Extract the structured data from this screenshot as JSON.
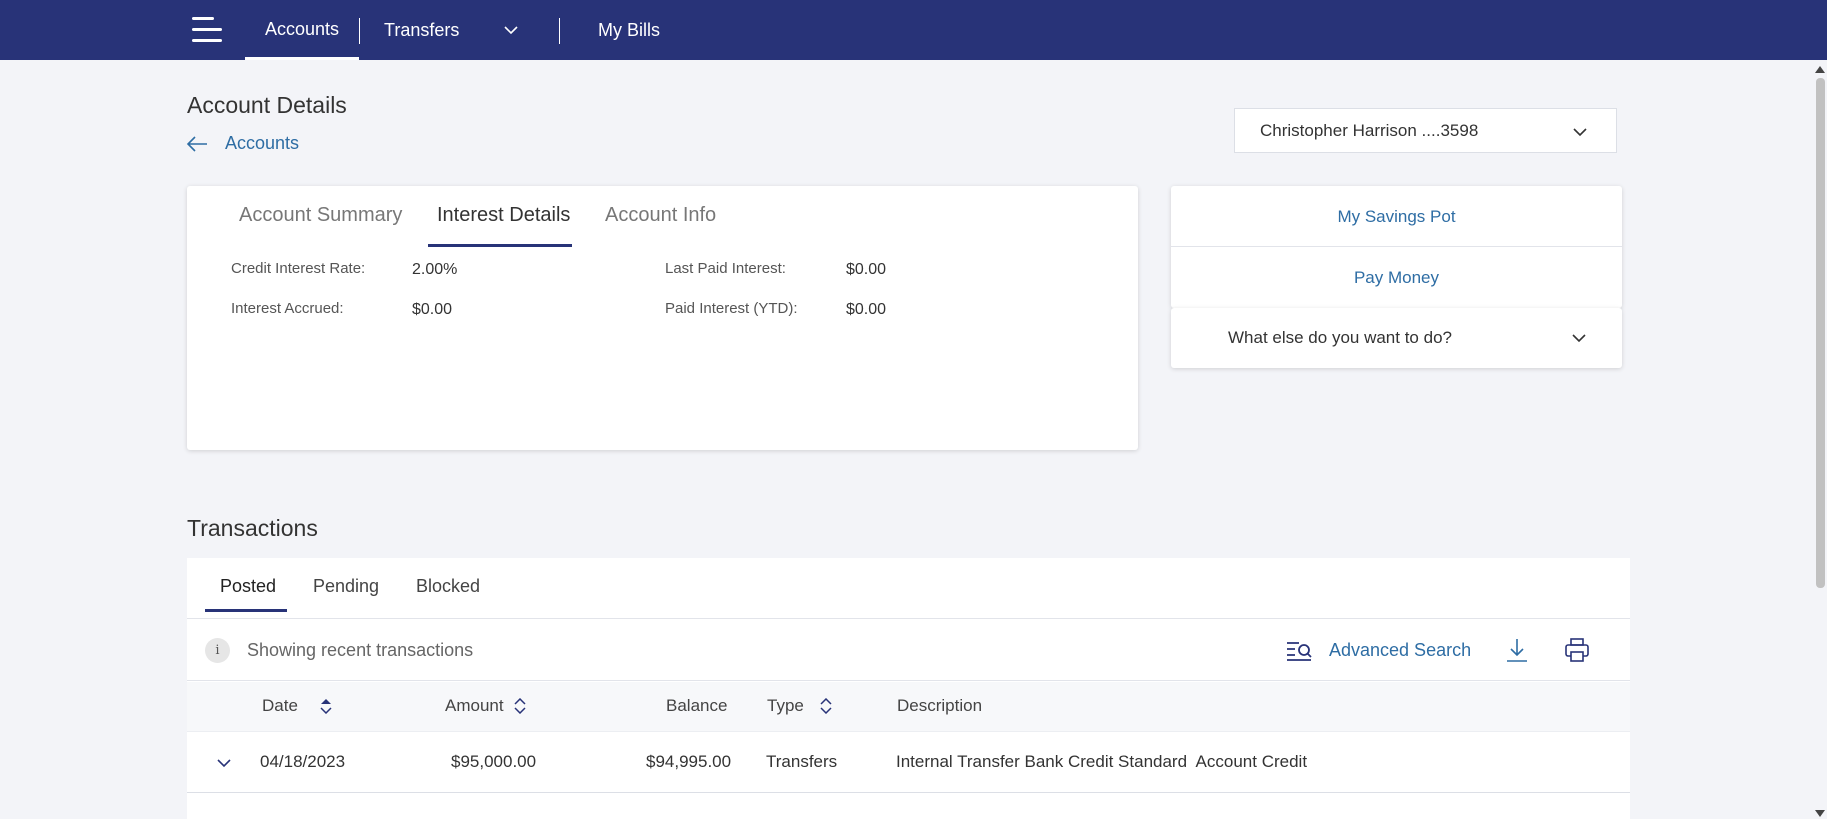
{
  "nav": {
    "items": [
      {
        "label": "Accounts"
      },
      {
        "label": "Transfers"
      },
      {
        "label": "My Bills"
      }
    ]
  },
  "page": {
    "title": "Account Details",
    "back_label": "Accounts"
  },
  "account_selector": {
    "value": "Christopher Harrison ....3598"
  },
  "details_card": {
    "tabs": [
      "Account Summary",
      "Interest Details",
      "Account Info"
    ],
    "active_tab": "Interest Details",
    "fields": {
      "credit_interest_rate": {
        "label": "Credit Interest Rate:",
        "value": "2.00%"
      },
      "interest_accrued": {
        "label": "Interest Accrued:",
        "value": "$0.00"
      },
      "last_paid_interest": {
        "label": "Last Paid Interest:",
        "value": "$0.00"
      },
      "paid_interest_ytd": {
        "label": "Paid Interest (YTD):",
        "value": "$0.00"
      }
    }
  },
  "actions": {
    "items": [
      "My Savings Pot",
      "Pay Money"
    ],
    "more_label": "What else do you want to do?"
  },
  "transactions": {
    "title": "Transactions",
    "tabs": [
      "Posted",
      "Pending",
      "Blocked"
    ],
    "active_tab": "Posted",
    "info_icon": "i",
    "status_text": "Showing recent transactions",
    "advanced_search_label": "Advanced Search",
    "columns": [
      "Date",
      "Amount",
      "Balance",
      "Type",
      "Description"
    ],
    "rows": [
      {
        "date": "04/18/2023",
        "amount": "$95,000.00",
        "balance": "$94,995.00",
        "type": "Transfers",
        "description": "Internal Transfer Bank Credit Standard  Account Credit"
      }
    ]
  },
  "colors": {
    "nav_bg": "#283378",
    "link": "#2e6da4",
    "page_bg": "#f3f4f8"
  }
}
